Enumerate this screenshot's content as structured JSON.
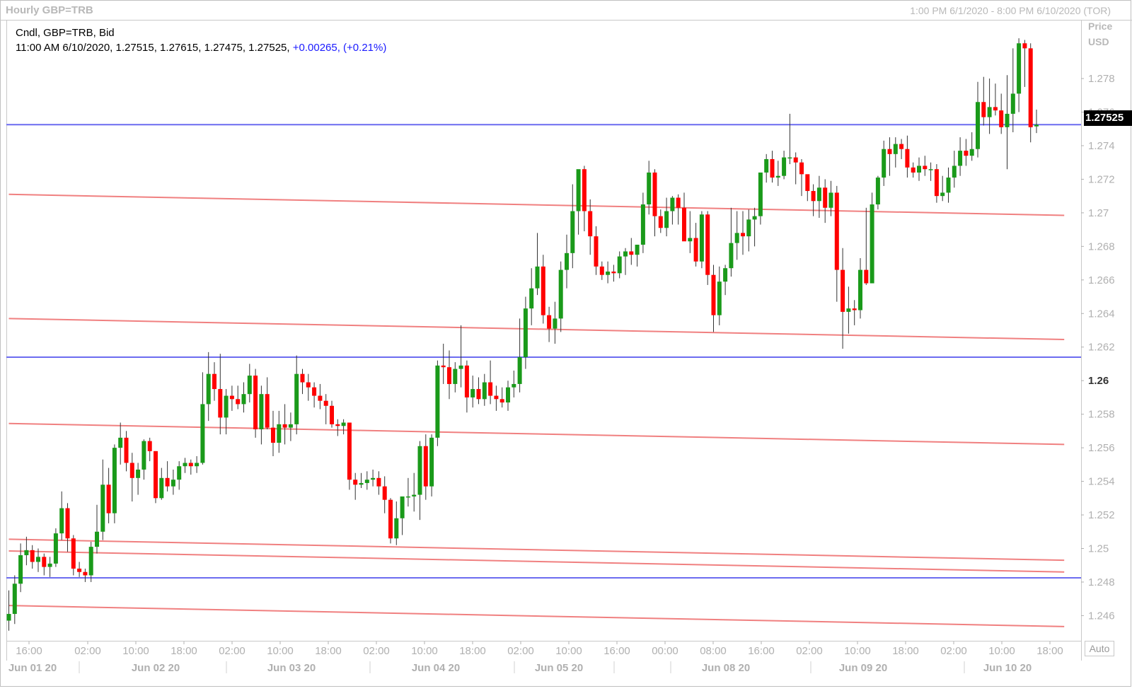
{
  "header": {
    "title": "Hourly GBP=TRB",
    "range": "1:00 PM 6/1/2020 - 8:00 PM 6/10/2020 (TOR)"
  },
  "info": {
    "line1": "Cndl, GBP=TRB, Bid",
    "line2_values": "11:00 AM 6/10/2020, 1.27515, 1.27615, 1.27475, 1.27525, ",
    "change": "+0.00265, (+0.21%)"
  },
  "price_axis": {
    "title_line1": "Price",
    "title_line2": "USD",
    "current_price": "1.27525",
    "auto_button": "Auto"
  },
  "colors": {
    "up": "#1a9a1a",
    "down": "#ff0000",
    "trendline": "#f08080",
    "level": "#6c6cf0",
    "grid_text": "#b0b0b0"
  },
  "chart_data": {
    "type": "candlestick",
    "title": "Hourly GBP=TRB",
    "ylim": [
      1.2445,
      1.2815
    ],
    "y_ticks": [
      "1.278",
      "1.276",
      "1.274",
      "1.272",
      "1.27",
      "1.268",
      "1.266",
      "1.264",
      "1.262",
      "1.26",
      "1.258",
      "1.256",
      "1.254",
      "1.252",
      "1.25",
      "1.248",
      "1.246"
    ],
    "bold_tick": "1.26",
    "x_time_labels": [
      "16:00",
      "02:00",
      "10:00",
      "18:00",
      "02:00",
      "10:00",
      "18:00",
      "02:00",
      "10:00",
      "18:00",
      "02:00",
      "10:00",
      "16:00",
      "00:00",
      "08:00",
      "16:00",
      "02:00",
      "10:00",
      "18:00",
      "02:00",
      "10:00",
      "18:00"
    ],
    "x_date_labels": [
      "Jun 01 20",
      "Jun 02 20",
      "Jun 03 20",
      "Jun 04 20",
      "Jun 05 20",
      "Jun 08 20",
      "Jun 09 20",
      "Jun 10 20"
    ],
    "horizontal_levels": [
      1.27525,
      1.2614,
      1.24825
    ],
    "trendlines": [
      {
        "from": [
          0,
          1.2711
        ],
        "to": [
          179,
          1.26985
        ]
      },
      {
        "from": [
          0,
          1.2637
        ],
        "to": [
          179,
          1.26245
        ]
      },
      {
        "from": [
          0,
          1.25745
        ],
        "to": [
          179,
          1.2562
        ]
      },
      {
        "from": [
          0,
          1.25055
        ],
        "to": [
          179,
          1.2493
        ]
      },
      {
        "from": [
          0,
          1.24985
        ],
        "to": [
          179,
          1.2486
        ]
      },
      {
        "from": [
          0,
          1.2466
        ],
        "to": [
          179,
          1.24535
        ]
      }
    ],
    "ohlc": [
      [
        1.2457,
        1.2475,
        1.2451,
        1.2461
      ],
      [
        1.2461,
        1.2484,
        1.2455,
        1.2479
      ],
      [
        1.2479,
        1.2503,
        1.2474,
        1.2496
      ],
      [
        1.2496,
        1.2507,
        1.249,
        1.2499
      ],
      [
        1.2499,
        1.2502,
        1.2488,
        1.2492
      ],
      [
        1.2492,
        1.25,
        1.2486,
        1.2495
      ],
      [
        1.2495,
        1.2497,
        1.2484,
        1.2489
      ],
      [
        1.2489,
        1.2495,
        1.2483,
        1.2491
      ],
      [
        1.2491,
        1.2512,
        1.2489,
        1.2509
      ],
      [
        1.2509,
        1.2534,
        1.2505,
        1.2524
      ],
      [
        1.2524,
        1.2527,
        1.2498,
        1.2506
      ],
      [
        1.2506,
        1.2508,
        1.2484,
        1.2488
      ],
      [
        1.2488,
        1.2492,
        1.2483,
        1.2486
      ],
      [
        1.2486,
        1.2488,
        1.248,
        1.2484
      ],
      [
        1.2484,
        1.2504,
        1.248,
        1.2501
      ],
      [
        1.2501,
        1.2526,
        1.2497,
        1.251
      ],
      [
        1.251,
        1.2553,
        1.2505,
        1.2538
      ],
      [
        1.2538,
        1.2548,
        1.2515,
        1.2521
      ],
      [
        1.2521,
        1.2562,
        1.2515,
        1.256
      ],
      [
        1.256,
        1.2575,
        1.255,
        1.2566
      ],
      [
        1.2566,
        1.257,
        1.2546,
        1.2551
      ],
      [
        1.2551,
        1.2557,
        1.2528,
        1.2542
      ],
      [
        1.2542,
        1.2551,
        1.2532,
        1.2547
      ],
      [
        1.2547,
        1.2565,
        1.2541,
        1.2564
      ],
      [
        1.2564,
        1.2566,
        1.2552,
        1.2558
      ],
      [
        1.2558,
        1.2558,
        1.2527,
        1.253
      ],
      [
        1.253,
        1.2548,
        1.2529,
        1.2542
      ],
      [
        1.2542,
        1.2552,
        1.2534,
        1.2537
      ],
      [
        1.2537,
        1.2547,
        1.2532,
        1.2541
      ],
      [
        1.2541,
        1.2552,
        1.2535,
        1.2549
      ],
      [
        1.2549,
        1.2554,
        1.2545,
        1.2551
      ],
      [
        1.2551,
        1.2553,
        1.2544,
        1.2549
      ],
      [
        1.2549,
        1.2555,
        1.2545,
        1.2551
      ],
      [
        1.2551,
        1.2605,
        1.255,
        1.2586
      ],
      [
        1.2586,
        1.2617,
        1.2576,
        1.2604
      ],
      [
        1.2604,
        1.2611,
        1.2588,
        1.2595
      ],
      [
        1.2595,
        1.2616,
        1.2568,
        1.2578
      ],
      [
        1.2578,
        1.2595,
        1.2568,
        1.2591
      ],
      [
        1.2591,
        1.2597,
        1.2582,
        1.2589
      ],
      [
        1.2589,
        1.2597,
        1.2583,
        1.2586
      ],
      [
        1.2586,
        1.2599,
        1.2581,
        1.2592
      ],
      [
        1.2592,
        1.261,
        1.2587,
        1.2603
      ],
      [
        1.2603,
        1.2607,
        1.2566,
        1.2571
      ],
      [
        1.2571,
        1.2597,
        1.2562,
        1.2592
      ],
      [
        1.2592,
        1.2602,
        1.2571,
        1.2572
      ],
      [
        1.2572,
        1.2582,
        1.2555,
        1.2563
      ],
      [
        1.2563,
        1.2582,
        1.2557,
        1.2574
      ],
      [
        1.2574,
        1.2586,
        1.2562,
        1.2572
      ],
      [
        1.2572,
        1.2581,
        1.2564,
        1.2574
      ],
      [
        1.2574,
        1.2615,
        1.2568,
        1.2604
      ],
      [
        1.2604,
        1.2607,
        1.2592,
        1.2599
      ],
      [
        1.2599,
        1.2604,
        1.2588,
        1.2596
      ],
      [
        1.2596,
        1.2599,
        1.2584,
        1.2591
      ],
      [
        1.2591,
        1.2598,
        1.2583,
        1.2588
      ],
      [
        1.2588,
        1.2592,
        1.2574,
        1.2585
      ],
      [
        1.2585,
        1.2588,
        1.2572,
        1.2574
      ],
      [
        1.2574,
        1.2577,
        1.2567,
        1.2573
      ],
      [
        1.2573,
        1.2577,
        1.2568,
        1.2575
      ],
      [
        1.2575,
        1.2575,
        1.2535,
        1.2541
      ],
      [
        1.2541,
        1.2545,
        1.2529,
        1.2538
      ],
      [
        1.2538,
        1.2545,
        1.2536,
        1.2539
      ],
      [
        1.2539,
        1.2546,
        1.2535,
        1.2541
      ],
      [
        1.2541,
        1.2547,
        1.2537,
        1.2542
      ],
      [
        1.2542,
        1.2546,
        1.2532,
        1.2537
      ],
      [
        1.2537,
        1.2543,
        1.2521,
        1.2529
      ],
      [
        1.2529,
        1.253,
        1.2503,
        1.2506
      ],
      [
        1.2506,
        1.2528,
        1.2502,
        1.2518
      ],
      [
        1.2518,
        1.2526,
        1.2508,
        1.2531
      ],
      [
        1.2531,
        1.2542,
        1.2525,
        1.2531
      ],
      [
        1.2531,
        1.2545,
        1.2522,
        1.2532
      ],
      [
        1.2532,
        1.2564,
        1.2517,
        1.2561
      ],
      [
        1.2561,
        1.2568,
        1.2529,
        1.2537
      ],
      [
        1.2537,
        1.2568,
        1.2531,
        1.2566
      ],
      [
        1.2566,
        1.2612,
        1.2561,
        1.2609
      ],
      [
        1.2609,
        1.2622,
        1.2598,
        1.2608
      ],
      [
        1.2608,
        1.2618,
        1.2589,
        1.2598
      ],
      [
        1.2598,
        1.2611,
        1.2593,
        1.2607
      ],
      [
        1.2607,
        1.2633,
        1.2596,
        1.2609
      ],
      [
        1.2609,
        1.2612,
        1.2581,
        1.259
      ],
      [
        1.259,
        1.2603,
        1.2584,
        1.2595
      ],
      [
        1.2595,
        1.2602,
        1.2586,
        1.2589
      ],
      [
        1.2589,
        1.2604,
        1.2585,
        1.2599
      ],
      [
        1.2599,
        1.2612,
        1.2586,
        1.2591
      ],
      [
        1.2591,
        1.2597,
        1.2582,
        1.2589
      ],
      [
        1.2589,
        1.2596,
        1.2584,
        1.2587
      ],
      [
        1.2587,
        1.26,
        1.2582,
        1.2596
      ],
      [
        1.2596,
        1.2606,
        1.259,
        1.2598
      ],
      [
        1.2598,
        1.2637,
        1.2593,
        1.2614
      ],
      [
        1.2614,
        1.265,
        1.2607,
        1.2643
      ],
      [
        1.2643,
        1.2667,
        1.2633,
        1.2655
      ],
      [
        1.2655,
        1.2688,
        1.2651,
        1.2668
      ],
      [
        1.2668,
        1.2675,
        1.2634,
        1.2639
      ],
      [
        1.2639,
        1.2644,
        1.2623,
        1.2631
      ],
      [
        1.2631,
        1.2647,
        1.2622,
        1.2637
      ],
      [
        1.2637,
        1.2671,
        1.2629,
        1.2666
      ],
      [
        1.2666,
        1.2687,
        1.2655,
        1.2676
      ],
      [
        1.2676,
        1.2717,
        1.2667,
        1.2701
      ],
      [
        1.2701,
        1.2725,
        1.2687,
        1.2726
      ],
      [
        1.2726,
        1.2728,
        1.2689,
        1.2701
      ],
      [
        1.2701,
        1.2708,
        1.2675,
        1.2686
      ],
      [
        1.2686,
        1.2692,
        1.2663,
        1.2668
      ],
      [
        1.2668,
        1.2671,
        1.266,
        1.2663
      ],
      [
        1.2663,
        1.2671,
        1.2658,
        1.2665
      ],
      [
        1.2665,
        1.2669,
        1.2659,
        1.2664
      ],
      [
        1.2664,
        1.2677,
        1.2661,
        1.2674
      ],
      [
        1.2674,
        1.2679,
        1.2663,
        1.2677
      ],
      [
        1.2677,
        1.2685,
        1.2669,
        1.2675
      ],
      [
        1.2675,
        1.2681,
        1.2668,
        1.2681
      ],
      [
        1.2681,
        1.2712,
        1.2676,
        1.2705
      ],
      [
        1.2705,
        1.2731,
        1.2699,
        1.2724
      ],
      [
        1.2724,
        1.2726,
        1.2686,
        1.2698
      ],
      [
        1.2698,
        1.2702,
        1.2688,
        1.2691
      ],
      [
        1.2691,
        1.2709,
        1.2686,
        1.2701
      ],
      [
        1.2701,
        1.271,
        1.2693,
        1.2709
      ],
      [
        1.2709,
        1.2711,
        1.2693,
        1.2703
      ],
      [
        1.2703,
        1.2712,
        1.2692,
        1.2683
      ],
      [
        1.2683,
        1.2701,
        1.2676,
        1.2685
      ],
      [
        1.2685,
        1.2694,
        1.2668,
        1.2671
      ],
      [
        1.2671,
        1.2701,
        1.2667,
        1.2699
      ],
      [
        1.2699,
        1.2701,
        1.2657,
        1.2663
      ],
      [
        1.2663,
        1.2669,
        1.2629,
        1.2639
      ],
      [
        1.2639,
        1.2668,
        1.2633,
        1.2659
      ],
      [
        1.2659,
        1.2669,
        1.2651,
        1.2667
      ],
      [
        1.2667,
        1.2703,
        1.2662,
        1.2682
      ],
      [
        1.2682,
        1.2701,
        1.2672,
        1.2688
      ],
      [
        1.2688,
        1.2701,
        1.2675,
        1.2686
      ],
      [
        1.2686,
        1.2702,
        1.2677,
        1.2696
      ],
      [
        1.2696,
        1.2703,
        1.268,
        1.2698
      ],
      [
        1.2698,
        1.2722,
        1.2693,
        1.2724
      ],
      [
        1.2724,
        1.2735,
        1.2718,
        1.2732
      ],
      [
        1.2732,
        1.2737,
        1.2718,
        1.2721
      ],
      [
        1.2721,
        1.2731,
        1.2716,
        1.2722
      ],
      [
        1.2722,
        1.2737,
        1.272,
        1.2733
      ],
      [
        1.2733,
        1.2759,
        1.2729,
        1.2733
      ],
      [
        1.2733,
        1.2736,
        1.2717,
        1.273
      ],
      [
        1.273,
        1.2732,
        1.271,
        1.2723
      ],
      [
        1.2723,
        1.272,
        1.2707,
        1.2713
      ],
      [
        1.2713,
        1.2717,
        1.2698,
        1.2707
      ],
      [
        1.2707,
        1.2722,
        1.2697,
        1.2715
      ],
      [
        1.2715,
        1.272,
        1.2694,
        1.2703
      ],
      [
        1.2703,
        1.2719,
        1.2698,
        1.2712
      ],
      [
        1.2712,
        1.2716,
        1.2647,
        1.2666
      ],
      [
        1.2666,
        1.2679,
        1.2619,
        1.2641
      ],
      [
        1.2641,
        1.2656,
        1.2628,
        1.2643
      ],
      [
        1.2643,
        1.2648,
        1.2633,
        1.2642
      ],
      [
        1.2642,
        1.2673,
        1.2637,
        1.2666
      ],
      [
        1.2666,
        1.2703,
        1.2657,
        1.2658
      ],
      [
        1.2658,
        1.2712,
        1.2658,
        1.2705
      ],
      [
        1.2705,
        1.2722,
        1.2702,
        1.2721
      ],
      [
        1.2721,
        1.2743,
        1.2716,
        1.2738
      ],
      [
        1.2738,
        1.2745,
        1.2722,
        1.2735
      ],
      [
        1.2735,
        1.2745,
        1.2727,
        1.2741
      ],
      [
        1.2741,
        1.2744,
        1.2732,
        1.2738
      ],
      [
        1.2738,
        1.2746,
        1.2721,
        1.2727
      ],
      [
        1.2727,
        1.273,
        1.2721,
        1.2724
      ],
      [
        1.2724,
        1.2733,
        1.2719,
        1.2728
      ],
      [
        1.2728,
        1.2734,
        1.2722,
        1.2726
      ],
      [
        1.2726,
        1.273,
        1.2719,
        1.2726
      ],
      [
        1.2726,
        1.2729,
        1.2706,
        1.271
      ],
      [
        1.271,
        1.2722,
        1.2707,
        1.2712
      ],
      [
        1.2712,
        1.2727,
        1.2706,
        1.2721
      ],
      [
        1.2721,
        1.2737,
        1.2715,
        1.2728
      ],
      [
        1.2728,
        1.2745,
        1.2722,
        1.2737
      ],
      [
        1.2737,
        1.2744,
        1.2728,
        1.2734
      ],
      [
        1.2734,
        1.2748,
        1.2731,
        1.2738
      ],
      [
        1.2738,
        1.2778,
        1.2733,
        1.2766
      ],
      [
        1.2766,
        1.2781,
        1.2752,
        1.2757
      ],
      [
        1.2757,
        1.278,
        1.2747,
        1.2763
      ],
      [
        1.2763,
        1.2777,
        1.2758,
        1.2761
      ],
      [
        1.2761,
        1.2771,
        1.2747,
        1.2751
      ],
      [
        1.2751,
        1.2782,
        1.2726,
        1.2759
      ],
      [
        1.2759,
        1.2798,
        1.2748,
        1.2771
      ],
      [
        1.2771,
        1.2804,
        1.276,
        1.2801
      ],
      [
        1.2801,
        1.2803,
        1.2775,
        1.2798
      ],
      [
        1.2798,
        1.2801,
        1.2742,
        1.2751
      ],
      [
        1.27515,
        1.27615,
        1.27475,
        1.27525
      ]
    ]
  }
}
